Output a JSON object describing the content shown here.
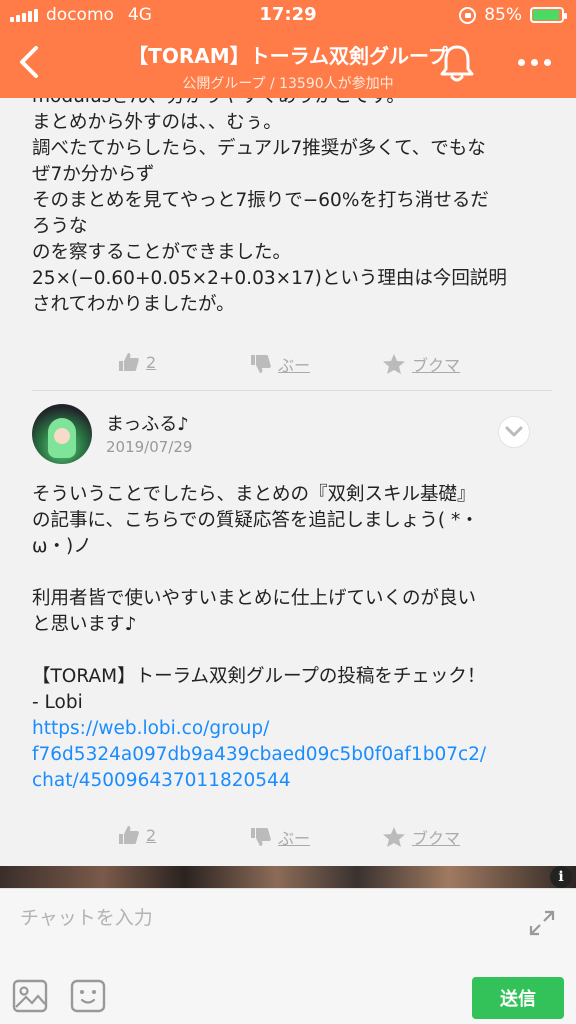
{
  "status_bar": {
    "carrier": "docomo",
    "network": "4G",
    "time": "17:29",
    "battery": "85%",
    "battery_level": 0.85
  },
  "header": {
    "title": "【TORAM】トーラム双剣グループ",
    "subtitle": "公開グループ / 13590人が参加中",
    "icons": [
      "back-chevron-icon",
      "bell-icon",
      "more-dots-icon"
    ]
  },
  "messages": [
    {
      "lines": [
        "modulusさん、分かりやすくありがとです。",
        "まとめから外すのは、、むぅ。",
        "調べたてからしたら、デュアル7推奨が多くて、でもな",
        "ぜ7か分からず",
        "そのまとめを見てやっと7振りで−60%を打ち消せるだ",
        "ろうな",
        "のを察することができました。",
        "25×(−0.60+0.05×2+0.03×17)という理由は今回説明",
        "されてわかりましたが。"
      ],
      "actions": {
        "like_count": "2",
        "dislike_label": "ぶー",
        "bookmark_label": "ブクマ"
      }
    },
    {
      "author": "まっふる♪",
      "date": "2019/07/29",
      "lines": [
        "そういうことでしたら、まとめの『双剣スキル基礎』",
        "の記事に、こちらでの質疑応答を追記しましょう( *・",
        "ω・)ノ",
        "",
        "利用者皆で使いやすいまとめに仕上げていくのが良い",
        "と思います♪",
        "",
        "【TORAM】トーラム双剣グループの投稿をチェック！",
        "- Lobi"
      ],
      "link_lines": [
        "https://web.lobi.co/group/",
        "f76d5324a097db9a439cbaed09c5b0f0af1b07c2/",
        "chat/450096437011820544"
      ],
      "actions": {
        "like_count": "2",
        "dislike_label": "ぶー",
        "bookmark_label": "ブクマ"
      }
    }
  ],
  "ad": {
    "info_label": "i"
  },
  "input": {
    "placeholder": "チャットを入力",
    "send_label": "送信"
  },
  "colors": {
    "header_orange": "#ff7b47",
    "send_green": "#33c15a",
    "link_blue": "#1a8cff"
  }
}
